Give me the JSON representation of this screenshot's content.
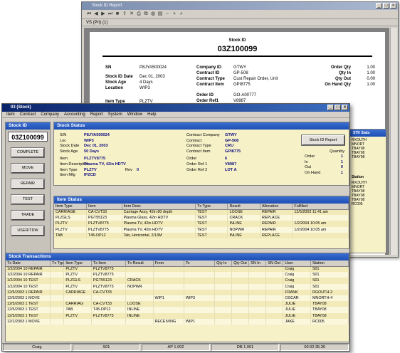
{
  "report": {
    "title": "Stock ID Report",
    "tab": "VS (Prt) (1)",
    "heading1": "Stock ID",
    "heading2": "03Z100099",
    "fields": [
      {
        "label": "SN",
        "value": "P8JYA500024"
      },
      {
        "label": "Stock ID Date",
        "value": "Dec 01, 2003"
      },
      {
        "label": "Stock Age",
        "value": "4 Days"
      },
      {
        "label": "Location",
        "value": "WIP3"
      },
      {
        "label": "Item Type",
        "value": "PLZTV"
      },
      {
        "label": "Company ID",
        "value": "GTWY"
      },
      {
        "label": "Contract ID",
        "value": "GP-508"
      },
      {
        "label": "Contract Type",
        "value": "Cust Repair Order, Unit"
      },
      {
        "label": "Contract Item",
        "value": "GPI8775"
      },
      {
        "label": "Order ID",
        "value": "GO-A00777"
      },
      {
        "label": "Order Ref1",
        "value": "V8987"
      },
      {
        "label": "Order Qty",
        "value": "1.00"
      },
      {
        "label": "Qty In",
        "value": "1.00"
      },
      {
        "label": "Qty Out",
        "value": "0.00"
      },
      {
        "label": "On Hand Qty",
        "value": "1.00"
      }
    ]
  },
  "main": {
    "title": "03 (Stock)",
    "menu": [
      "Item",
      "Contract",
      "Company",
      "Accounting",
      "Report",
      "System",
      "Window",
      "Help"
    ],
    "stock_id_label": "Stock ID",
    "stock_id": "03Z100099",
    "buttons": [
      "COMPLETE",
      "MOVE",
      "REPAIR",
      "TEST",
      "TRADE",
      "USER/TDW"
    ],
    "stock_status": {
      "header": "Stock Status",
      "left": [
        {
          "label": "S/N",
          "value": "P8JYA500024"
        },
        {
          "label": "Loc",
          "value": "WIP3"
        },
        {
          "label": "Stock Date",
          "value": "Dec 01, 2003"
        },
        {
          "label": "Stock Age",
          "value": "50 Days"
        },
        {
          "label": "Item",
          "value": "PLZTV8775"
        },
        {
          "label": "Item Description",
          "value": "Plasma TV, 42in HDTV"
        },
        {
          "label": "Item Type",
          "value": "PLZTV"
        },
        {
          "label": "Item Mfg",
          "value": "IPZCD"
        }
      ],
      "rev_label": "Rev",
      "rev_value": "0",
      "mid": [
        {
          "label": "Contract Company",
          "value": "GTWY"
        },
        {
          "label": "Contract",
          "value": "GP-508"
        },
        {
          "label": "Contract Type",
          "value": "CRU"
        },
        {
          "label": "Contract Item",
          "value": "GPI8775"
        },
        {
          "label": "Order",
          "value": "6"
        },
        {
          "label": "Order Ref 1",
          "value": "V8987"
        },
        {
          "label": "Order Ref 2",
          "value": "LOT A"
        }
      ],
      "report_button": "Stock ID Report",
      "qty_label": "Quantity",
      "qty": [
        {
          "label": "Order",
          "value": "1"
        },
        {
          "label": "In",
          "value": "1"
        },
        {
          "label": "Out",
          "value": "0"
        },
        {
          "label": "On Hand",
          "value": "1"
        }
      ]
    },
    "item_status": {
      "header": "Item Status",
      "columns": [
        "Item Type",
        "Item",
        "Item Desc",
        "Tx Type",
        "Result",
        "Allocation",
        "Fulfilled"
      ],
      "rows": [
        [
          "CARRIAGE",
          "CA-CVT33",
          "Carriage Assy, 42in 80 depth",
          "TEST",
          "LOOSE",
          "REPAIR",
          "12/5/2003 11:41 am"
        ],
        [
          "PLZGLS",
          "PGT55123",
          "Plasma Glass, 42in HDTV",
          "TEST",
          "CRACK",
          "REPLACE",
          ""
        ],
        [
          "PLZTV",
          "PLZTV8775",
          "Plasma TV, 42in HDTV",
          "TEST",
          "INLINE",
          "REPAIR",
          "1/2/2004 10:05 am"
        ],
        [
          "PLZTV",
          "PLZTV8775",
          "Plasma TV, 42in HDTV",
          "TEST",
          "NOPWR",
          "REPAIR",
          "1/2/2004 10:05 am"
        ],
        [
          "TAB",
          "T45-DP12",
          "Tab, Horizontal, 2/13M",
          "TEST",
          "INLINE",
          "REPLACE",
          ""
        ]
      ]
    },
    "transactions": {
      "header": "Stock Transactions",
      "columns": [
        "Tx Date",
        "Tx Type",
        "Item Type",
        "Tx Item",
        "Tx Result",
        "From",
        "To",
        "Qty In",
        "Qty Out",
        "SN In",
        "SN Out",
        "User",
        "Station"
      ],
      "rows": [
        [
          "1/2/2004 10 REPAIR",
          "",
          "PLZTV",
          "PLZTV8775",
          "",
          "",
          "",
          "",
          "",
          "",
          "",
          "Craig",
          "S01"
        ],
        [
          "1/2/2004 10 REPAIR",
          "",
          "PLZTV",
          "PLZTV8775",
          "",
          "",
          "",
          "",
          "",
          "",
          "",
          "Craig",
          "S01"
        ],
        [
          "1/2/2004 10 TEST",
          "",
          "PLZGLS",
          "PGT55123",
          "CRACK",
          "",
          "",
          "",
          "",
          "",
          "",
          "Craig",
          "S01"
        ],
        [
          "1/2/2004 10 TEST",
          "",
          "PLZTV",
          "PLZTV8775",
          "NOPWR",
          "",
          "",
          "",
          "",
          "",
          "",
          "Craig",
          "S01"
        ],
        [
          "12/5/2003 1 REPAIR",
          "",
          "CARRIAGE",
          "CA-CVT33",
          "",
          "",
          "",
          "",
          "",
          "",
          "",
          "FRANK",
          "RGOUTH-2"
        ],
        [
          "12/5/2003 1 MOVE",
          "",
          "",
          "",
          "",
          "WIP1",
          "WIP3",
          "",
          "",
          "",
          "",
          "OSCAR",
          "MNORTH-4"
        ],
        [
          "12/5/2003 1 TEST",
          "",
          "CARRIAG",
          "CA-CVT33",
          "LOOSE",
          "",
          "",
          "",
          "",
          "",
          "",
          "JULIE",
          "TBAY08"
        ],
        [
          "12/5/2003 1 TEST",
          "",
          "TAB",
          "T45-DP12",
          "INLINE",
          "",
          "",
          "",
          "",
          "",
          "",
          "JULIE",
          "TBAY08"
        ],
        [
          "12/5/2003 1 TEST",
          "",
          "PLZTV",
          "PLZTV8775",
          "INLINE",
          "",
          "",
          "",
          "",
          "",
          "",
          "JULIE",
          "TBAY08"
        ],
        [
          "12/1/2003 1 MOVE",
          "",
          "",
          "",
          "",
          "RECEIVING",
          "WIP1",
          "",
          "",
          "",
          "",
          "JAKE",
          "RC005"
        ]
      ]
    },
    "statusbar": [
      "Craig",
      "S01",
      "AP 1.002",
      "DB 1.001",
      "00:02:35:30"
    ]
  },
  "side_peek": {
    "header": "STK Stats",
    "col": "Station",
    "items_top": [
      "RXOUTH",
      "MNORT",
      "TBAY08",
      "TBAY08",
      "TBAY08"
    ],
    "items_bottom": [
      "RXOUTH",
      "MNORT",
      "TBAY08",
      "TBAY08",
      "TBAY08",
      "RC005"
    ]
  }
}
